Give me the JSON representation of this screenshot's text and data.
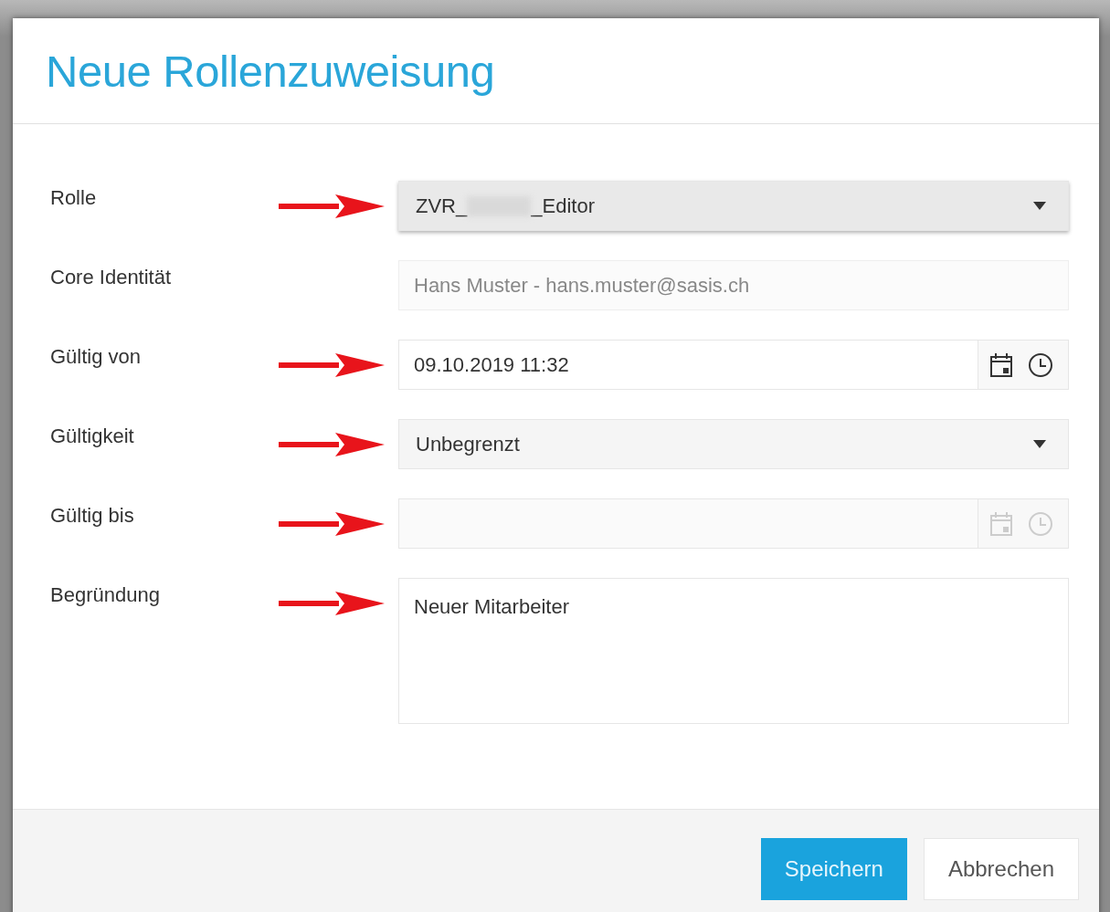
{
  "dialog": {
    "title": "Neue Rollenzuweisung"
  },
  "fields": [
    {
      "label": "Rolle",
      "kind": "select",
      "value_prefix": "ZVR_",
      "redacted": true,
      "value_suffix": "_Editor",
      "arrow": true
    },
    {
      "label": "Core Identität",
      "kind": "readonly",
      "value": "Hans Muster -  hans.muster@sasis.ch",
      "arrow": false
    },
    {
      "label": "Gültig von",
      "kind": "datetime",
      "value": "09.10.2019 11:32",
      "disabled": false,
      "arrow": true
    },
    {
      "label": "Gültigkeit",
      "kind": "select",
      "value_prefix": "Unbegrenzt",
      "redacted": false,
      "arrow": true
    },
    {
      "label": "Gültig bis",
      "kind": "datetime",
      "disabled": true,
      "arrow": true
    },
    {
      "label": "Begründung",
      "kind": "textarea",
      "value": "Neuer Mitarbeiter",
      "arrow": true
    }
  ],
  "buttons": [
    {
      "label": "Speichern",
      "kind": "primary"
    },
    {
      "label": "Abbrechen",
      "kind": "secondary"
    }
  ]
}
